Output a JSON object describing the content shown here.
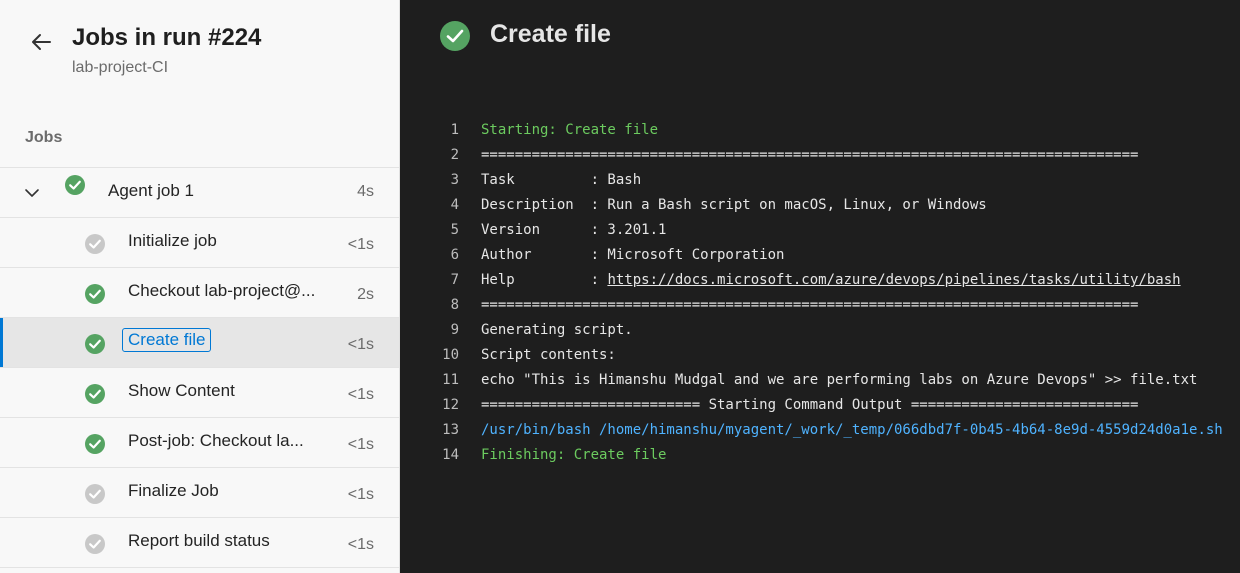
{
  "header": {
    "title": "Jobs in run #224",
    "subtitle": "lab-project-CI"
  },
  "section_label": "Jobs",
  "jobs": [
    {
      "label": "Agent job 1",
      "time": "4s",
      "status": "success",
      "level": 0,
      "expanded": true
    },
    {
      "label": "Initialize job",
      "time": "<1s",
      "status": "skipped",
      "level": 1
    },
    {
      "label": "Checkout lab-project@...",
      "time": "2s",
      "status": "success",
      "level": 1
    },
    {
      "label": "Create file",
      "time": "<1s",
      "status": "success",
      "level": 1,
      "selected": true
    },
    {
      "label": "Show Content",
      "time": "<1s",
      "status": "success",
      "level": 1
    },
    {
      "label": "Post-job: Checkout la...",
      "time": "<1s",
      "status": "success",
      "level": 1
    },
    {
      "label": "Finalize Job",
      "time": "<1s",
      "status": "skipped",
      "level": 1
    },
    {
      "label": "Report build status",
      "time": "<1s",
      "status": "skipped",
      "level": 1
    }
  ],
  "log": {
    "title": "Create file",
    "lines": [
      {
        "n": "1",
        "text": "Starting: Create file",
        "style": "green"
      },
      {
        "n": "2",
        "text": "==============================================================================",
        "style": "normal"
      },
      {
        "n": "3",
        "text": "Task         : Bash",
        "style": "normal"
      },
      {
        "n": "4",
        "text": "Description  : Run a Bash script on macOS, Linux, or Windows",
        "style": "normal"
      },
      {
        "n": "5",
        "text": "Version      : 3.201.1",
        "style": "normal"
      },
      {
        "n": "6",
        "text": "Author       : Microsoft Corporation",
        "style": "normal"
      },
      {
        "n": "7",
        "prefix": "Help         : ",
        "link": "https://docs.microsoft.com/azure/devops/pipelines/tasks/utility/bash",
        "style": "normal"
      },
      {
        "n": "8",
        "text": "==============================================================================",
        "style": "normal"
      },
      {
        "n": "9",
        "text": "Generating script.",
        "style": "normal"
      },
      {
        "n": "10",
        "text": "Script contents:",
        "style": "normal"
      },
      {
        "n": "11",
        "text": "echo \"This is Himanshu Mudgal and we are performing labs on Azure Devops\" >> file.txt",
        "style": "normal"
      },
      {
        "n": "12",
        "text": "========================== Starting Command Output ===========================",
        "style": "normal"
      },
      {
        "n": "13",
        "text": "/usr/bin/bash /home/himanshu/myagent/_work/_temp/066dbd7f-0b45-4b64-8e9d-4559d24d0a1e.sh",
        "style": "blue"
      },
      {
        "n": "14",
        "text": "Finishing: Create file",
        "style": "green"
      }
    ]
  },
  "colors": {
    "success": "#55a362",
    "skipped": "#c8c8c8",
    "accent": "#0078d4"
  }
}
